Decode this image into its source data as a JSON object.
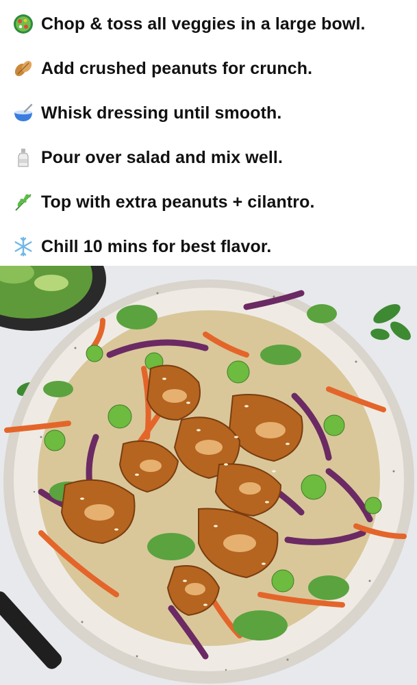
{
  "steps": [
    {
      "icon": "salad-icon",
      "text": "Chop & toss all veggies in a large bowl."
    },
    {
      "icon": "peanuts-icon",
      "text": "Add crushed peanuts for crunch."
    },
    {
      "icon": "bowl-with-spoon-icon",
      "text": "Whisk dressing until smooth."
    },
    {
      "icon": "bottle-icon",
      "text": "Pour over salad and mix well."
    },
    {
      "icon": "herb-icon",
      "text": "Top with extra peanuts + cilantro."
    },
    {
      "icon": "snowflake-icon",
      "text": "Chill 10 mins for best flavor."
    }
  ],
  "photo": {
    "subject": "sesame-chicken-slaw-bowl"
  }
}
